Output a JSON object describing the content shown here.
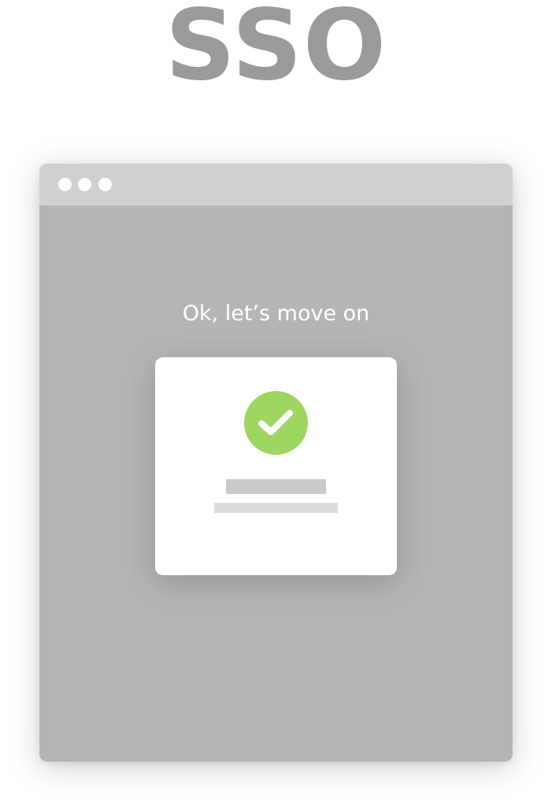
{
  "heading": {
    "text": "SSO",
    "color": "#9a9a9a"
  },
  "browser": {
    "titlebar_dots": [
      "dot",
      "dot",
      "dot"
    ],
    "message": "Ok, let’s move on",
    "card": {
      "icon": "check-circle-icon",
      "icon_color": "#9fd662"
    }
  }
}
